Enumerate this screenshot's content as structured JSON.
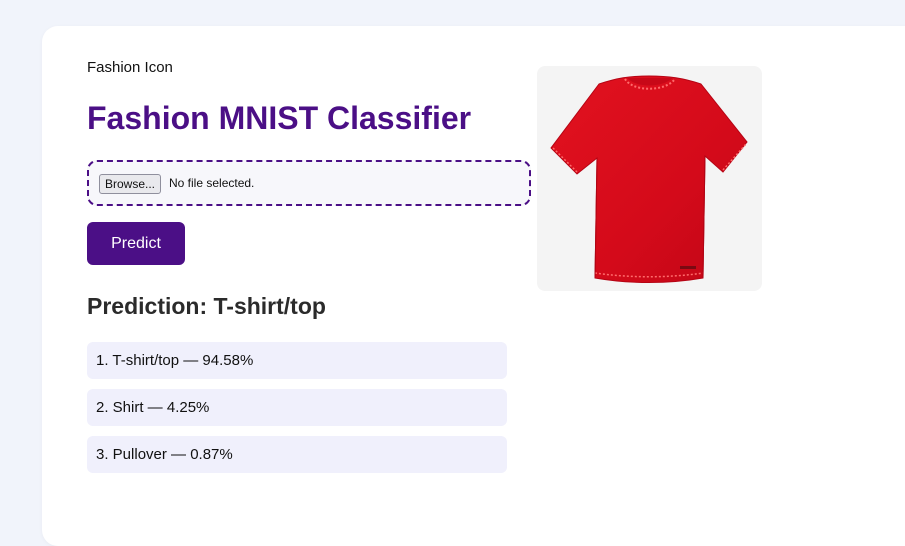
{
  "header": {
    "logo_alt": "Fashion Icon",
    "title": "Fashion MNIST Classifier"
  },
  "upload": {
    "browse_label": "Browse...",
    "file_status": "No file selected."
  },
  "actions": {
    "predict_label": "Predict"
  },
  "prediction": {
    "heading": "Prediction: T-shirt/top",
    "top_results": [
      {
        "text": "1. T-shirt/top — 94.58%",
        "label": "T-shirt/top",
        "confidence_percent": 94.58
      },
      {
        "text": "2. Shirt — 4.25%",
        "label": "Shirt",
        "confidence_percent": 4.25
      },
      {
        "text": "3. Pullover — 0.87%",
        "label": "Pullover",
        "confidence_percent": 0.87
      }
    ]
  },
  "preview": {
    "image": "red-tshirt-photo"
  },
  "colors": {
    "accent": "#4b0f86",
    "page_background": "#f1f4fb",
    "result_background": "#f0f0fc",
    "shirt_red": "#dc0a1e"
  }
}
